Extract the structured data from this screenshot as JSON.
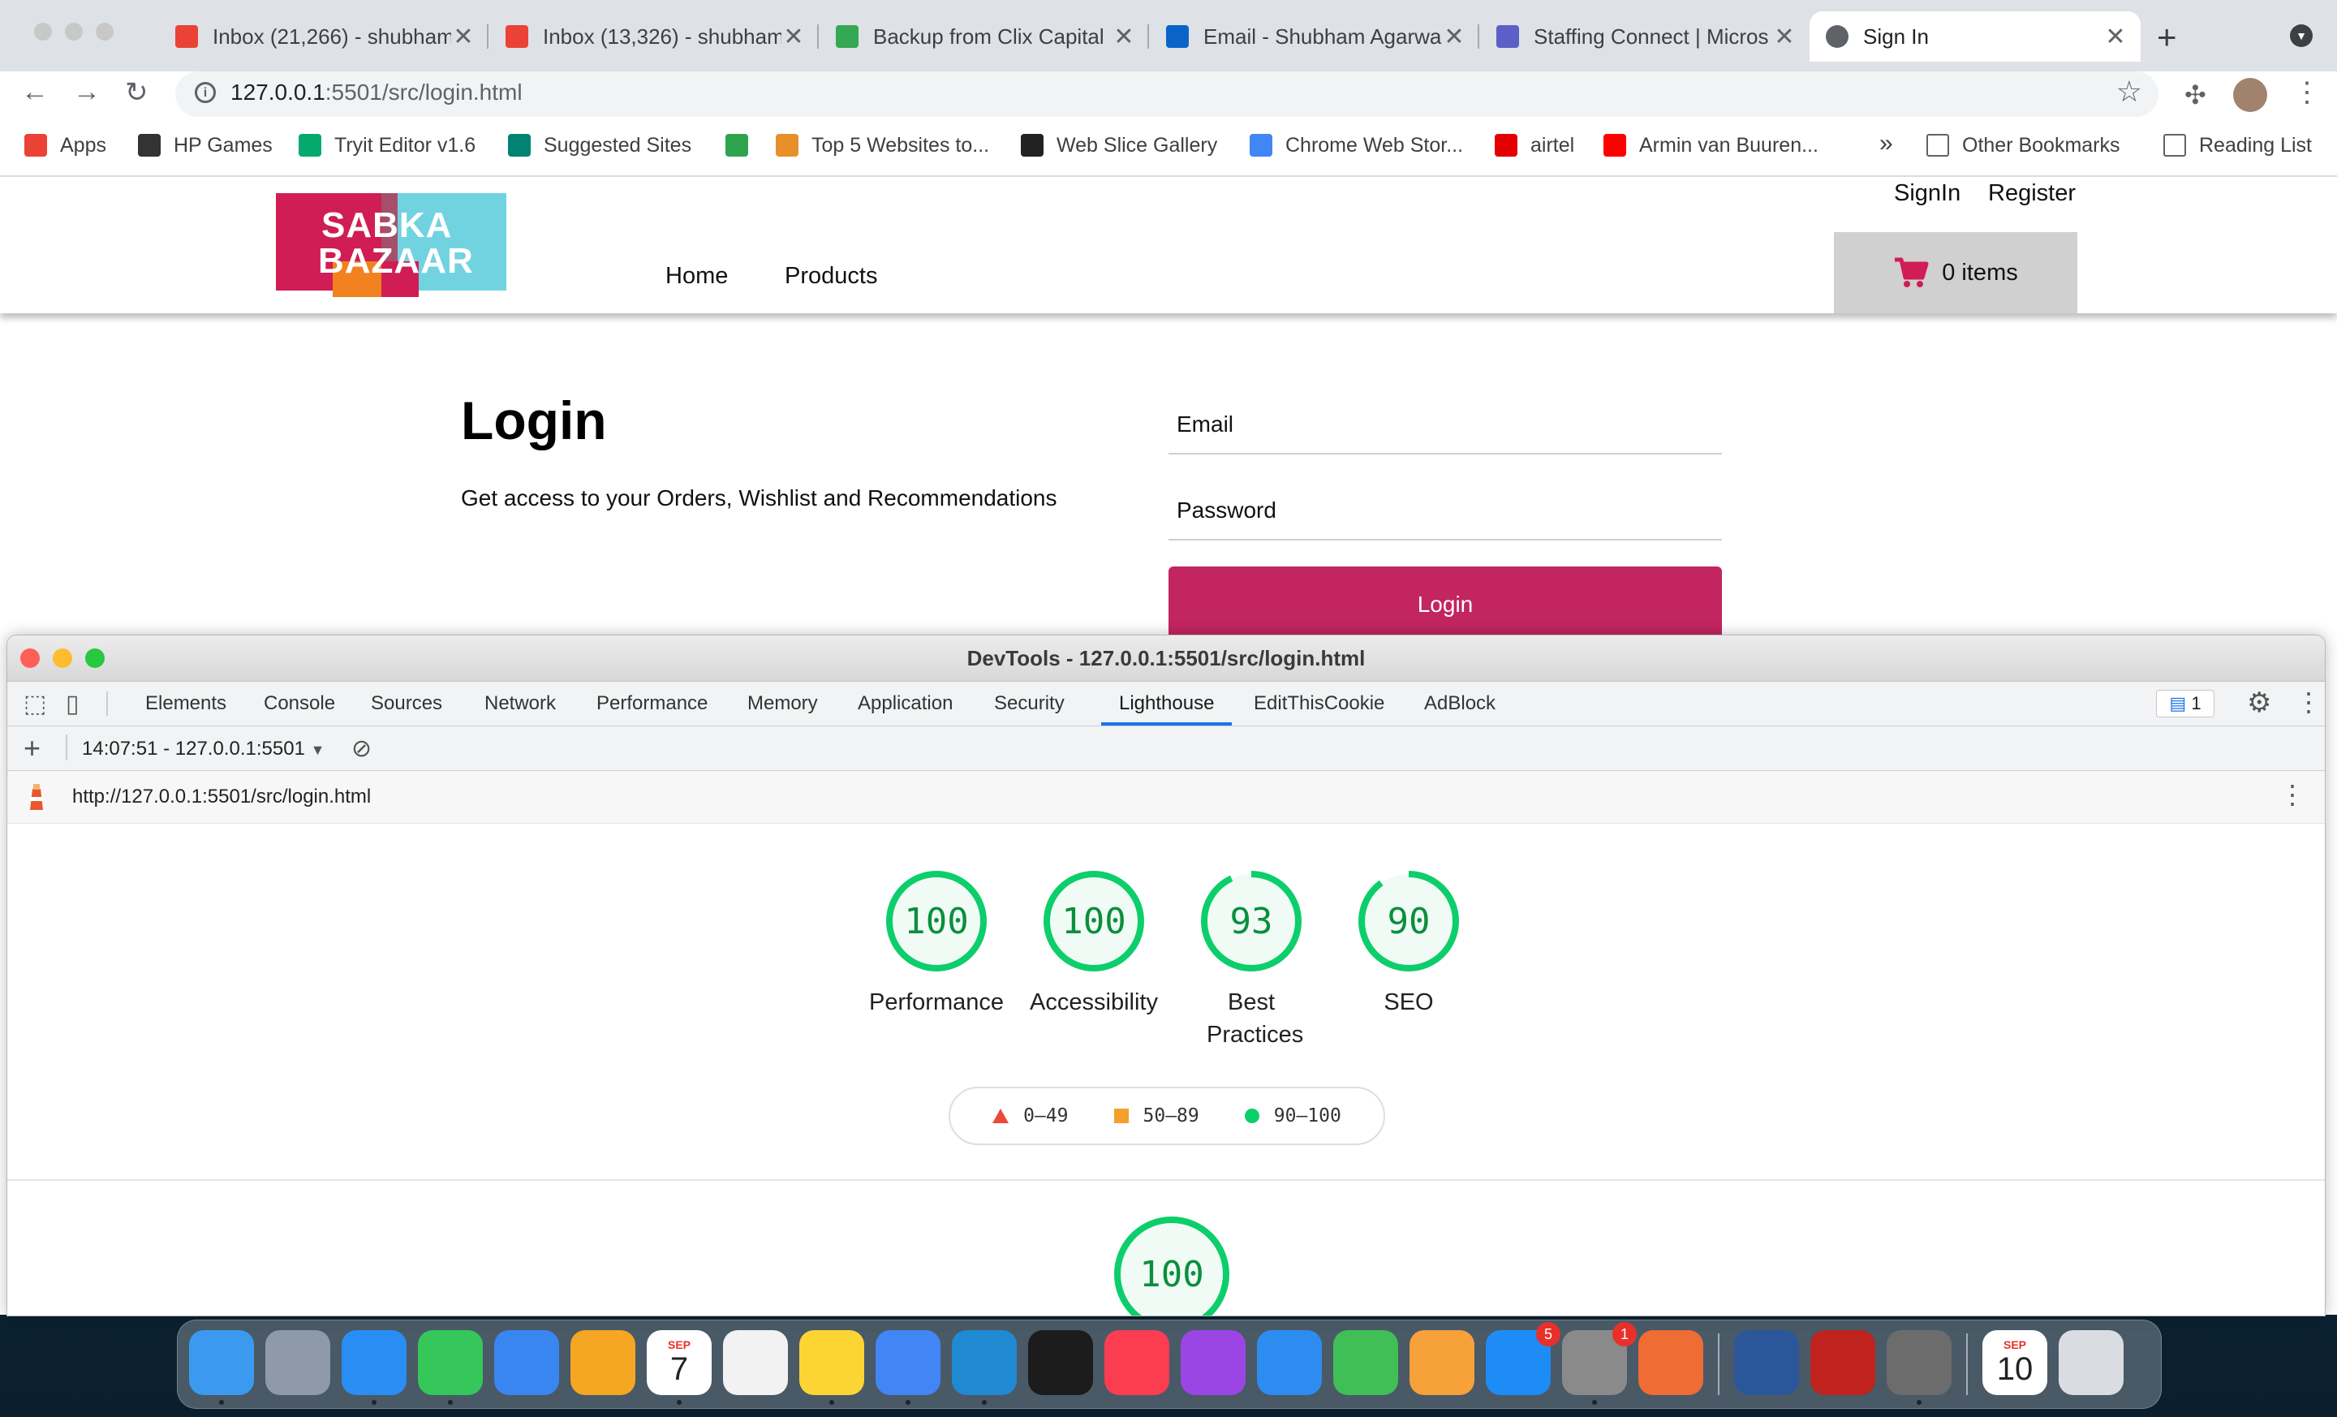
{
  "browser": {
    "tabs": [
      {
        "title": "Inbox (21,266) - shubham",
        "icon": "gmail-icon",
        "active": false
      },
      {
        "title": "Inbox (13,326) - shubham",
        "icon": "gmail-icon",
        "active": false
      },
      {
        "title": "Backup from Clix Capital",
        "icon": "google-drive-icon",
        "active": false
      },
      {
        "title": "Email - Shubham Agarwa",
        "icon": "outlook-icon",
        "active": false
      },
      {
        "title": "Staffing Connect | Micros",
        "icon": "teams-icon",
        "active": false
      },
      {
        "title": "Sign In",
        "icon": "globe-icon",
        "active": true
      }
    ],
    "new_tab_symbol": "+",
    "close_symbol": "✕",
    "address": {
      "host": "127.0.0.1",
      "rest": ":5501/src/login.html"
    },
    "bookmarks": [
      {
        "label": "Apps",
        "icon": "apps-grid-icon",
        "color": "#ea4335"
      },
      {
        "label": "HP Games",
        "icon": "hp-icon",
        "color": "#333333"
      },
      {
        "label": "Tryit Editor v1.6",
        "icon": "w3schools-icon",
        "color": "#04aa6d"
      },
      {
        "label": "Suggested Sites",
        "icon": "bing-icon",
        "color": "#008373"
      },
      {
        "label": "",
        "icon": "bing-icon",
        "color": "#2ea44f"
      },
      {
        "label": "Top 5 Websites to...",
        "icon": "ftm-icon",
        "color": "#e88f2a"
      },
      {
        "label": "Web Slice Gallery",
        "icon": "web-slice-icon",
        "color": "#222222"
      },
      {
        "label": "Chrome Web Stor...",
        "icon": "chrome-store-icon",
        "color": "#4285f4"
      },
      {
        "label": "airtel",
        "icon": "airtel-icon",
        "color": "#e40000"
      },
      {
        "label": "Armin van Buuren...",
        "icon": "youtube-icon",
        "color": "#ff0000"
      }
    ],
    "overflow_symbol": "»",
    "other_bookmarks": "Other Bookmarks",
    "reading_list": "Reading List"
  },
  "site": {
    "logo_line1": "SABKA",
    "logo_line2": "BAZAAR",
    "nav": [
      "Home",
      "Products"
    ],
    "signin": "SignIn",
    "register": "Register",
    "cart_label": "0 items",
    "login_title": "Login",
    "login_subtitle": "Get access to your Orders, Wishlist and Recommendations",
    "email_placeholder": "Email",
    "password_placeholder": "Password",
    "login_button": "Login",
    "accent_color": "#c2255f"
  },
  "devtools": {
    "title": "DevTools - 127.0.0.1:5501/src/login.html",
    "tabs": [
      "Elements",
      "Console",
      "Sources",
      "Network",
      "Performance",
      "Memory",
      "Application",
      "Security",
      "Lighthouse",
      "EditThisCookie",
      "AdBlock"
    ],
    "active_tab": "Lighthouse",
    "issues_count": "1",
    "report_selector": "14:07:51 - 127.0.0.1:5501",
    "report_url": "http://127.0.0.1:5501/src/login.html",
    "scores": [
      {
        "label": "Performance",
        "value": 100
      },
      {
        "label": "Accessibility",
        "value": 100
      },
      {
        "label": "Best Practices",
        "value": 93
      },
      {
        "label": "SEO",
        "value": 90
      }
    ],
    "legend": [
      {
        "range": "0–49",
        "color": "#eb4a3a",
        "shape": "triangle"
      },
      {
        "range": "50–89",
        "color": "#f4a02c",
        "shape": "square"
      },
      {
        "range": "90–100",
        "color": "#0cce6b",
        "shape": "circle"
      }
    ],
    "section_score": 100,
    "pass_color": "#0cce6b"
  },
  "dock": {
    "apps": [
      {
        "name": "finder-icon",
        "color": "#3b9af0"
      },
      {
        "name": "launchpad-icon",
        "color": "#8f9aa8"
      },
      {
        "name": "safari-icon",
        "color": "#2a8df3"
      },
      {
        "name": "messages-icon",
        "color": "#35c759"
      },
      {
        "name": "mail-icon",
        "color": "#3a86f0"
      },
      {
        "name": "photos-icon",
        "color": "#f5a623"
      },
      {
        "name": "calendar-icon",
        "color": "#ffffff",
        "month": "SEP",
        "day": "7"
      },
      {
        "name": "reminders-icon",
        "color": "#f2f2f2"
      },
      {
        "name": "notes-icon",
        "color": "#fcd535"
      },
      {
        "name": "chrome-icon",
        "color": "#4285f4"
      },
      {
        "name": "vscode-icon",
        "color": "#1f8ad2"
      },
      {
        "name": "terminal-icon",
        "color": "#1c1c1c"
      },
      {
        "name": "music-icon",
        "color": "#fb3c51"
      },
      {
        "name": "podcasts-icon",
        "color": "#9b46e4"
      },
      {
        "name": "keynote-icon",
        "color": "#2d8cf0"
      },
      {
        "name": "numbers-icon",
        "color": "#3fbf55"
      },
      {
        "name": "pages-icon",
        "color": "#f7a13a"
      },
      {
        "name": "app-store-icon",
        "color": "#1e8cf7",
        "badge": "5"
      },
      {
        "name": "system-preferences-icon",
        "color": "#8a8a8a",
        "badge": "1"
      },
      {
        "name": "postman-icon",
        "color": "#ef6c35"
      },
      {
        "name": "word-icon",
        "color": "#2b579a"
      },
      {
        "name": "acrobat-icon",
        "color": "#c0221d"
      },
      {
        "name": "calculator-icon",
        "color": "#6c6c6c"
      },
      {
        "name": "calendar-doc-icon",
        "color": "#ffffff",
        "month": "SEP",
        "day": "10"
      },
      {
        "name": "trash-icon",
        "color": "#d9dde2"
      }
    ]
  }
}
